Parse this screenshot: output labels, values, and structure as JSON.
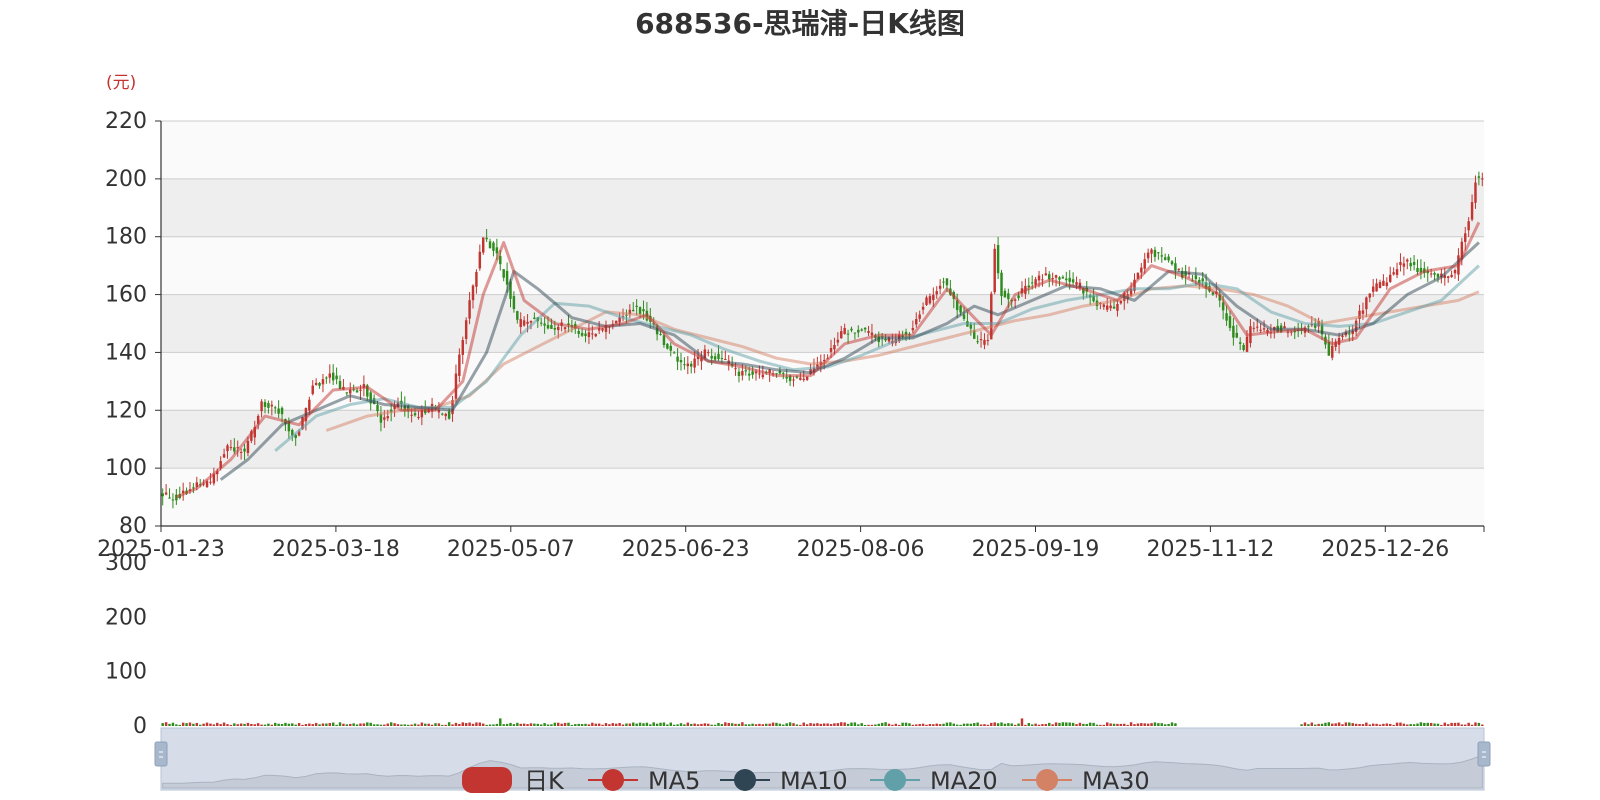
{
  "chart_data": {
    "type": "candlestick",
    "title": "688536-思瑞浦-日K线图",
    "y_unit_label": "(元)",
    "price_axis": {
      "min": 80,
      "max": 220,
      "ticks": [
        80,
        100,
        120,
        140,
        160,
        180,
        200,
        220
      ]
    },
    "volume_axis": {
      "min": 0,
      "max": 300,
      "ticks": [
        0,
        100,
        200,
        300
      ]
    },
    "x_tick_labels": [
      "2025-01-23",
      "2025-03-18",
      "2025-05-07",
      "2025-06-23",
      "2025-08-06",
      "2025-09-19",
      "2025-11-12",
      "2025-12-26"
    ],
    "grid": true,
    "legend_position": "bottom",
    "legend": [
      {
        "name": "日K",
        "color": "#c23531"
      },
      {
        "name": "MA5",
        "color": "#c23531"
      },
      {
        "name": "MA10",
        "color": "#2f4554"
      },
      {
        "name": "MA20",
        "color": "#61a0a8"
      },
      {
        "name": "MA30",
        "color": "#d48265"
      }
    ],
    "up_color": "#c23531",
    "down_color": "#2e8b1e",
    "price_path": [
      [
        0,
        91
      ],
      [
        5,
        90
      ],
      [
        10,
        94
      ],
      [
        15,
        95
      ],
      [
        20,
        108
      ],
      [
        25,
        105
      ],
      [
        30,
        122
      ],
      [
        35,
        120
      ],
      [
        40,
        110
      ],
      [
        45,
        128
      ],
      [
        50,
        132
      ],
      [
        55,
        126
      ],
      [
        60,
        128
      ],
      [
        65,
        117
      ],
      [
        70,
        122
      ],
      [
        75,
        118
      ],
      [
        80,
        121
      ],
      [
        85,
        118
      ],
      [
        90,
        152
      ],
      [
        95,
        180
      ],
      [
        98,
        176
      ],
      [
        102,
        164
      ],
      [
        105,
        150
      ],
      [
        110,
        152
      ],
      [
        115,
        148
      ],
      [
        120,
        150
      ],
      [
        125,
        146
      ],
      [
        130,
        148
      ],
      [
        135,
        152
      ],
      [
        140,
        156
      ],
      [
        145,
        149
      ],
      [
        150,
        140
      ],
      [
        155,
        135
      ],
      [
        160,
        140
      ],
      [
        165,
        138
      ],
      [
        170,
        133
      ],
      [
        175,
        132
      ],
      [
        180,
        133
      ],
      [
        185,
        131
      ],
      [
        190,
        132
      ],
      [
        195,
        137
      ],
      [
        200,
        147
      ],
      [
        205,
        148
      ],
      [
        210,
        145
      ],
      [
        215,
        144
      ],
      [
        220,
        147
      ],
      [
        225,
        158
      ],
      [
        230,
        165
      ],
      [
        235,
        153
      ],
      [
        240,
        143
      ],
      [
        243,
        144
      ],
      [
        245,
        176
      ],
      [
        247,
        160
      ],
      [
        250,
        158
      ],
      [
        255,
        163
      ],
      [
        260,
        167
      ],
      [
        265,
        165
      ],
      [
        270,
        163
      ],
      [
        275,
        156
      ],
      [
        280,
        155
      ],
      [
        285,
        162
      ],
      [
        290,
        175
      ],
      [
        295,
        172
      ],
      [
        300,
        167
      ],
      [
        305,
        165
      ],
      [
        310,
        160
      ],
      [
        315,
        146
      ],
      [
        318,
        141
      ],
      [
        320,
        148
      ],
      [
        325,
        148
      ],
      [
        330,
        148
      ],
      [
        335,
        148
      ],
      [
        340,
        150
      ],
      [
        343,
        139
      ],
      [
        346,
        145
      ],
      [
        350,
        148
      ],
      [
        355,
        161
      ],
      [
        360,
        165
      ],
      [
        365,
        172
      ],
      [
        370,
        168
      ],
      [
        375,
        166
      ],
      [
        380,
        168
      ],
      [
        382,
        178
      ],
      [
        384,
        185
      ],
      [
        386,
        200
      ]
    ],
    "volume_gap": [
      298,
      333
    ],
    "ma5": [
      [
        4,
        90
      ],
      [
        10,
        93
      ],
      [
        20,
        103
      ],
      [
        30,
        118
      ],
      [
        40,
        115
      ],
      [
        50,
        127
      ],
      [
        60,
        128
      ],
      [
        70,
        120
      ],
      [
        80,
        120
      ],
      [
        88,
        130
      ],
      [
        94,
        160
      ],
      [
        100,
        178
      ],
      [
        106,
        158
      ],
      [
        115,
        150
      ],
      [
        125,
        148
      ],
      [
        135,
        150
      ],
      [
        142,
        153
      ],
      [
        150,
        143
      ],
      [
        160,
        137
      ],
      [
        170,
        135
      ],
      [
        180,
        132
      ],
      [
        190,
        132
      ],
      [
        200,
        143
      ],
      [
        210,
        146
      ],
      [
        220,
        146
      ],
      [
        230,
        162
      ],
      [
        238,
        152
      ],
      [
        243,
        146
      ],
      [
        250,
        160
      ],
      [
        260,
        165
      ],
      [
        270,
        162
      ],
      [
        280,
        158
      ],
      [
        290,
        170
      ],
      [
        300,
        166
      ],
      [
        310,
        160
      ],
      [
        318,
        146
      ],
      [
        325,
        147
      ],
      [
        335,
        148
      ],
      [
        343,
        143
      ],
      [
        350,
        145
      ],
      [
        360,
        162
      ],
      [
        370,
        168
      ],
      [
        380,
        170
      ],
      [
        386,
        185
      ]
    ],
    "ma10": [
      [
        17,
        96
      ],
      [
        25,
        103
      ],
      [
        35,
        115
      ],
      [
        45,
        120
      ],
      [
        55,
        125
      ],
      [
        65,
        122
      ],
      [
        75,
        121
      ],
      [
        85,
        120
      ],
      [
        95,
        140
      ],
      [
        103,
        168
      ],
      [
        110,
        162
      ],
      [
        120,
        152
      ],
      [
        130,
        149
      ],
      [
        140,
        150
      ],
      [
        150,
        146
      ],
      [
        160,
        137
      ],
      [
        170,
        136
      ],
      [
        180,
        134
      ],
      [
        190,
        133
      ],
      [
        200,
        138
      ],
      [
        210,
        145
      ],
      [
        220,
        145
      ],
      [
        230,
        150
      ],
      [
        238,
        156
      ],
      [
        245,
        153
      ],
      [
        255,
        158
      ],
      [
        265,
        163
      ],
      [
        275,
        162
      ],
      [
        285,
        158
      ],
      [
        295,
        168
      ],
      [
        305,
        167
      ],
      [
        315,
        156
      ],
      [
        325,
        148
      ],
      [
        335,
        148
      ],
      [
        345,
        146
      ],
      [
        355,
        150
      ],
      [
        365,
        160
      ],
      [
        375,
        166
      ],
      [
        386,
        178
      ]
    ],
    "ma20": [
      [
        33,
        106
      ],
      [
        45,
        118
      ],
      [
        55,
        122
      ],
      [
        65,
        124
      ],
      [
        75,
        121
      ],
      [
        85,
        121
      ],
      [
        95,
        130
      ],
      [
        105,
        146
      ],
      [
        115,
        157
      ],
      [
        125,
        156
      ],
      [
        135,
        152
      ],
      [
        145,
        149
      ],
      [
        155,
        146
      ],
      [
        165,
        141
      ],
      [
        175,
        137
      ],
      [
        185,
        134
      ],
      [
        195,
        135
      ],
      [
        205,
        139
      ],
      [
        215,
        144
      ],
      [
        225,
        147
      ],
      [
        235,
        150
      ],
      [
        245,
        150
      ],
      [
        255,
        155
      ],
      [
        265,
        158
      ],
      [
        275,
        160
      ],
      [
        285,
        162
      ],
      [
        295,
        162
      ],
      [
        305,
        164
      ],
      [
        315,
        162
      ],
      [
        325,
        154
      ],
      [
        335,
        150
      ],
      [
        345,
        149
      ],
      [
        355,
        150
      ],
      [
        365,
        154
      ],
      [
        375,
        158
      ],
      [
        386,
        170
      ]
    ],
    "ma30": [
      [
        48,
        113
      ],
      [
        60,
        118
      ],
      [
        70,
        120
      ],
      [
        80,
        121
      ],
      [
        90,
        125
      ],
      [
        100,
        136
      ],
      [
        110,
        142
      ],
      [
        120,
        148
      ],
      [
        130,
        154
      ],
      [
        140,
        153
      ],
      [
        150,
        148
      ],
      [
        160,
        145
      ],
      [
        170,
        142
      ],
      [
        180,
        138
      ],
      [
        190,
        136
      ],
      [
        200,
        137
      ],
      [
        210,
        139
      ],
      [
        220,
        142
      ],
      [
        230,
        145
      ],
      [
        240,
        148
      ],
      [
        250,
        151
      ],
      [
        260,
        153
      ],
      [
        270,
        156
      ],
      [
        280,
        158
      ],
      [
        290,
        162
      ],
      [
        300,
        163
      ],
      [
        310,
        162
      ],
      [
        320,
        160
      ],
      [
        330,
        156
      ],
      [
        340,
        150
      ],
      [
        350,
        152
      ],
      [
        360,
        154
      ],
      [
        370,
        156
      ],
      [
        380,
        158
      ],
      [
        386,
        161
      ]
    ]
  }
}
